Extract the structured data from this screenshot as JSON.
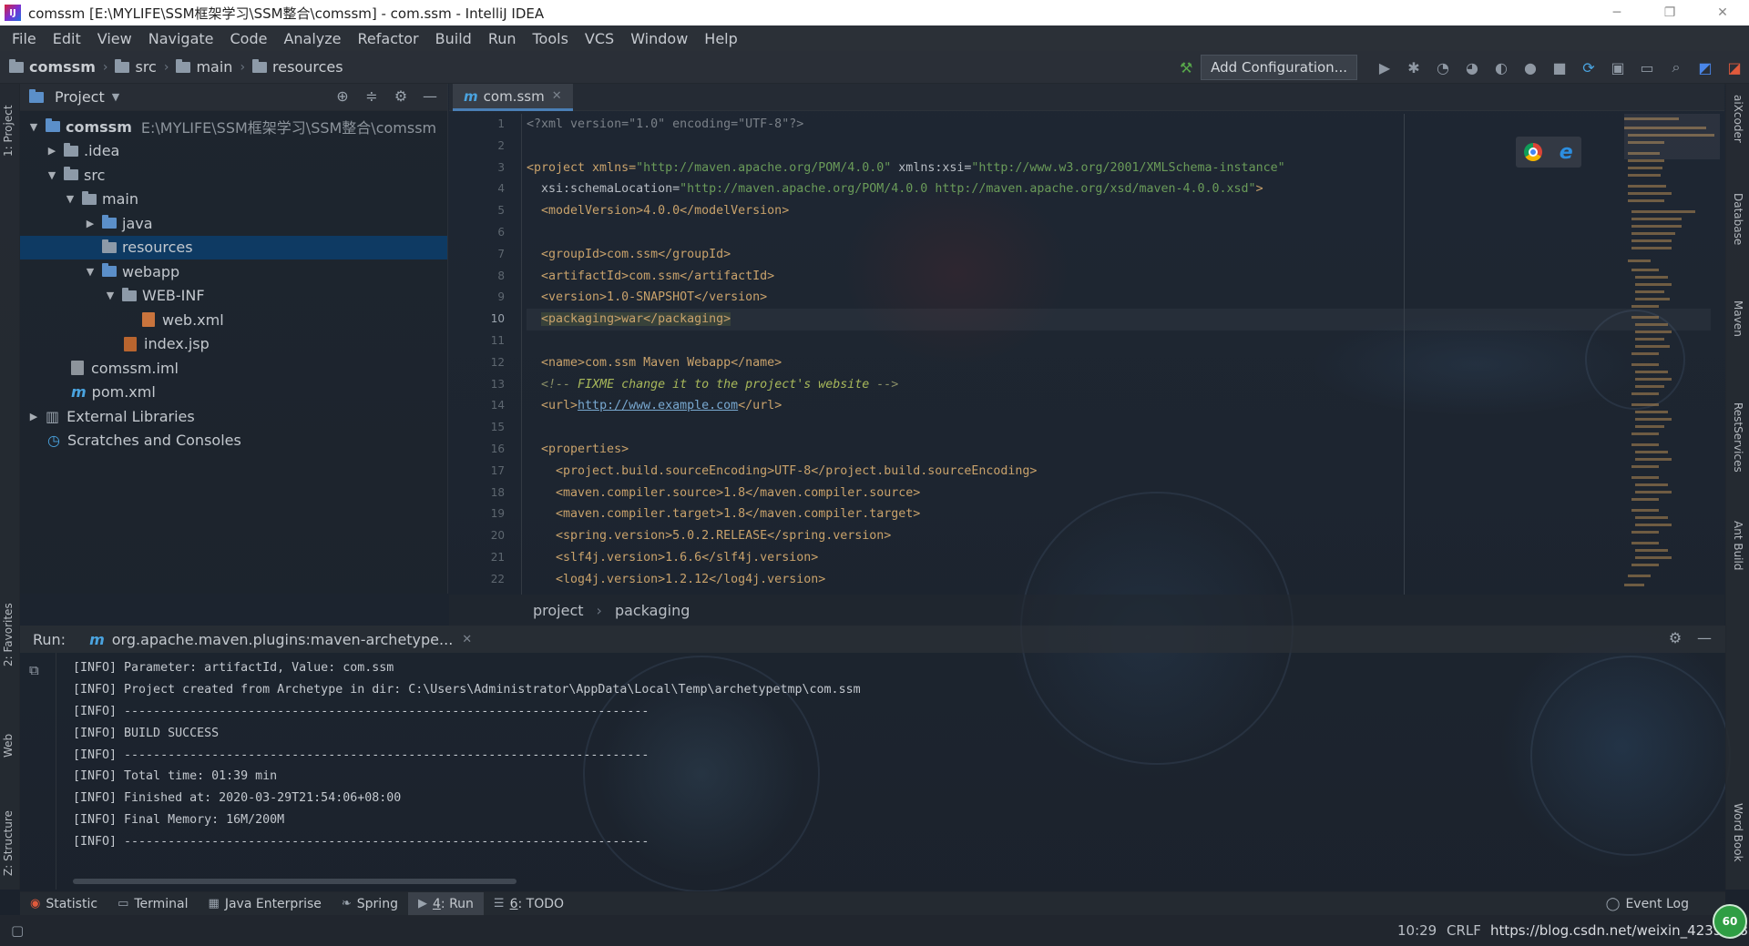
{
  "window": {
    "title": "comssm [E:\\MYLIFE\\SSM框架学习\\SSM整合\\comssm] - com.ssm - IntelliJ IDEA",
    "minimize": "─",
    "restore": "❐",
    "close": "✕"
  },
  "menu": [
    "File",
    "Edit",
    "View",
    "Navigate",
    "Code",
    "Analyze",
    "Refactor",
    "Build",
    "Run",
    "Tools",
    "VCS",
    "Window",
    "Help"
  ],
  "navbar": {
    "crumbs": [
      "comssm",
      "src",
      "main",
      "resources"
    ],
    "add_configuration": "Add Configuration..."
  },
  "project_panel": {
    "title": "Project",
    "tree": [
      {
        "label": "comssm",
        "path": "E:\\MYLIFE\\SSM框架学习\\SSM整合\\comssm",
        "arrow": "▼"
      },
      {
        "label": ".idea",
        "arrow": "▶"
      },
      {
        "label": "src",
        "arrow": "▼"
      },
      {
        "label": "main",
        "arrow": "▼"
      },
      {
        "label": "java",
        "arrow": "▶"
      },
      {
        "label": "resources",
        "arrow": ""
      },
      {
        "label": "webapp",
        "arrow": "▼"
      },
      {
        "label": "WEB-INF",
        "arrow": "▼"
      },
      {
        "label": "web.xml",
        "arrow": ""
      },
      {
        "label": "index.jsp",
        "arrow": ""
      },
      {
        "label": "comssm.iml",
        "arrow": ""
      },
      {
        "label": "pom.xml",
        "arrow": ""
      },
      {
        "label": "External Libraries",
        "arrow": "▶"
      },
      {
        "label": "Scratches and Consoles",
        "arrow": ""
      }
    ]
  },
  "editor": {
    "tab": "com.ssm",
    "tab_prefix": "m",
    "line_numbers": [
      "1",
      "2",
      "3",
      "4",
      "5",
      "6",
      "7",
      "8",
      "9",
      "10",
      "11",
      "12",
      "13",
      "14",
      "15",
      "16",
      "17",
      "18",
      "19",
      "20",
      "21",
      "22"
    ],
    "lines": {
      "l1": "<?xml version=\"1.0\" encoding=\"UTF-8\"?>",
      "l3a": "<project xmlns=",
      "l3b": "\"http://maven.apache.org/POM/4.0.0\"",
      "l3c": " xmlns:xsi=",
      "l3d": "\"http://www.w3.org/2001/XMLSchema-instance\"",
      "l4a": "  xsi:schemaLocation=",
      "l4b": "\"http://maven.apache.org/POM/4.0.0 http://maven.apache.org/xsd/maven-4.0.0.xsd\"",
      "l4c": ">",
      "l5": "  <modelVersion>4.0.0</modelVersion>",
      "l7": "  <groupId>com.ssm</groupId>",
      "l8": "  <artifactId>com.ssm</artifactId>",
      "l9": "  <version>1.0-SNAPSHOT</version>",
      "l10a": "  ",
      "l10b": "<packaging>war</packaging>",
      "l12": "  <name>com.ssm Maven Webapp</name>",
      "l13a": "  <!-- ",
      "l13b": "FIXME change it to the project's website",
      "l13c": " -->",
      "l14a": "  <url>",
      "l14b": "http://www.example.com",
      "l14c": "</url>",
      "l16": "  <properties>",
      "l17": "    <project.build.sourceEncoding>UTF-8</project.build.sourceEncoding>",
      "l18": "    <maven.compiler.source>1.8</maven.compiler.source>",
      "l19": "    <maven.compiler.target>1.8</maven.compiler.target>",
      "l20": "    <spring.version>5.0.2.RELEASE</spring.version>",
      "l21": "    <slf4j.version>1.6.6</slf4j.version>",
      "l22": "    <log4j.version>1.2.12</log4j.version>"
    },
    "breadcrumbs": [
      "project",
      "packaging"
    ]
  },
  "run": {
    "label": "Run:",
    "tab": "org.apache.maven.plugins:maven-archetype...",
    "tab_prefix": "m",
    "console": [
      "[INFO] Parameter: artifactId, Value: com.ssm",
      "[INFO] Project created from Archetype in dir: C:\\Users\\Administrator\\AppData\\Local\\Temp\\archetypetmp\\com.ssm",
      "[INFO] ------------------------------------------------------------------------",
      "[INFO] BUILD SUCCESS",
      "[INFO] ------------------------------------------------------------------------",
      "[INFO] Total time: 01:39 min",
      "[INFO] Finished at: 2020-03-29T21:54:06+08:00",
      "[INFO] Final Memory: 16M/200M",
      "[INFO] ------------------------------------------------------------------------"
    ]
  },
  "left_strip": [
    "1: Project",
    "2: Favorites",
    "Web",
    "Z: Structure"
  ],
  "right_strip": [
    "aiXcoder",
    "Database",
    "Maven",
    "RestServices",
    "Ant Build",
    "Word Book"
  ],
  "tool_tabs": [
    {
      "label": "Statistic",
      "num": ""
    },
    {
      "label": "Terminal",
      "num": ""
    },
    {
      "label": "Java Enterprise",
      "num": ""
    },
    {
      "label": "Spring",
      "num": ""
    },
    {
      "label": "Run",
      "num": "4"
    },
    {
      "label": "TODO",
      "num": "6"
    }
  ],
  "event_log": "Event Log",
  "status": {
    "position": "10:29",
    "line_sep": "CRLF",
    "watermark": "https://blog.csdn.net/weixin_42356887",
    "memory": "60"
  },
  "colors": {
    "selection": "#0e3a63",
    "xml_tag": "#c9a26b",
    "xml_string": "#6a9b59",
    "url": "#79a9d1"
  }
}
